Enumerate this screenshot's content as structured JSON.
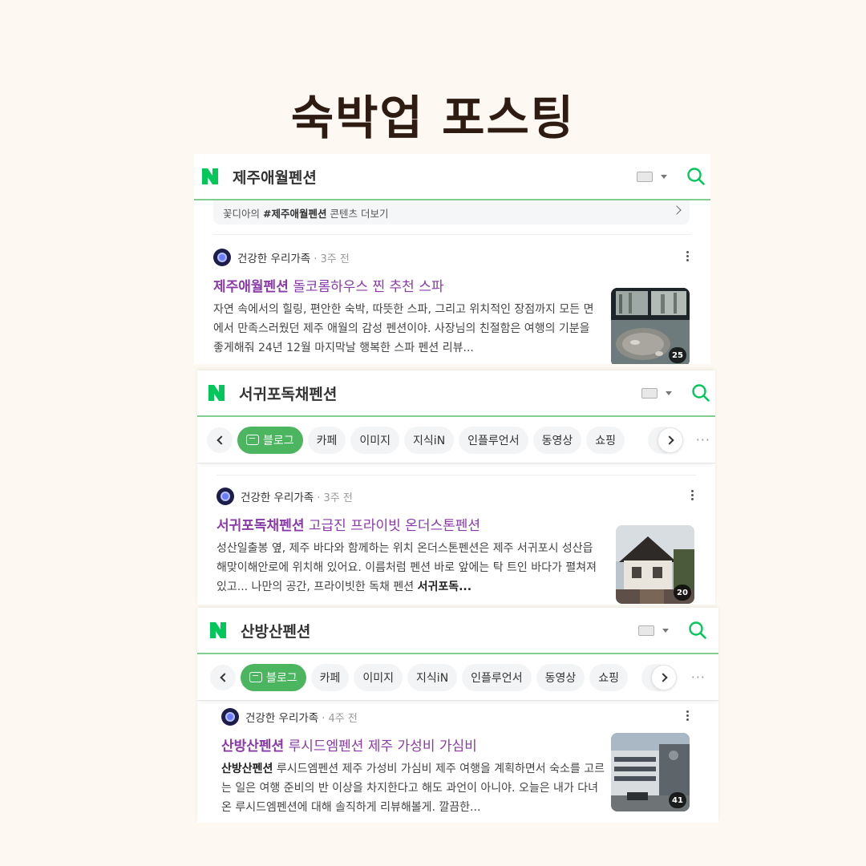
{
  "page": {
    "title": "숙박업 포스팅"
  },
  "cards": [
    {
      "query": "제주애월펜션",
      "more_link": {
        "prefix": "꽃디아의 ",
        "keyword": "#제주애월펜션",
        "suffix": " 콘텐츠 더보기"
      },
      "post": {
        "author": "건강한 우리가족",
        "ago": "· 3주 전",
        "title_keyword": "제주애월펜션",
        "title_rest": " 돌코롬하우스 찐 추천 스파",
        "body": "자연 속에서의 힐링, 편안한 숙박, 따뜻한 스파, 그리고 위치적인 장점까지 모든 면에서 만족스러웠던 제주 애월의 감성 펜션이야. 사장님의 친절함은 여행의 기분을 좋게해줘 24년 12월 마지막날 행복한 스파 펜션 리뷰...",
        "photo_count": "25"
      }
    },
    {
      "query": "서귀포독채펜션",
      "tabs": [
        "블로그",
        "카페",
        "이미지",
        "지식iN",
        "인플루언서",
        "동영상",
        "쇼핑"
      ],
      "post": {
        "author": "건강한 우리가족",
        "ago": "· 3주 전",
        "title_keyword": "서귀포독채펜션",
        "title_rest": " 고급진 프라이빗 온더스톤펜션",
        "body": "성산일출봉 옆, 제주 바다와 함께하는 위치 온더스톤펜션은 제주 서귀포시 성산읍 해맞이해안로에 위치해 있어요. 이름처럼 펜션 바로 앞에는 탁 트인 바다가 펼쳐져 있고... 나만의 공간, 프라이빗한 독채 펜션 ",
        "body_bold": "서귀포독...",
        "photo_count": "20"
      }
    },
    {
      "query": "산방산펜션",
      "tabs": [
        "블로그",
        "카페",
        "이미지",
        "지식iN",
        "인플루언서",
        "동영상",
        "쇼핑"
      ],
      "post": {
        "author": "건강한 우리가족",
        "ago": "· 4주 전",
        "title_keyword": "산방산펜션",
        "title_rest": " 루시드엠펜션 제주 가성비 가심비",
        "body_bold": "산방산펜션",
        "body": " 루시드엠펜션 제주 가성비 가심비 제주 여행을 계획하면서 숙소를 고르는 일은 여행 준비의 반 이상을 차지한다고 해도 과언이 아니야. 오늘은 내가 다녀온 루시드엠펜션에 대해 솔직하게 리뷰해볼게. 깔끔한...",
        "photo_count": "41"
      }
    }
  ],
  "colors": {
    "naver_green": "#03c75a",
    "title_purple": "#8a3aa8",
    "chip_active": "#4cb560",
    "background": "#fdf8f2"
  },
  "icons": [
    "naver-logo-icon",
    "keyboard-icon",
    "search-icon",
    "chevron-left-icon",
    "chevron-right-icon",
    "blog-icon",
    "more-icon"
  ]
}
